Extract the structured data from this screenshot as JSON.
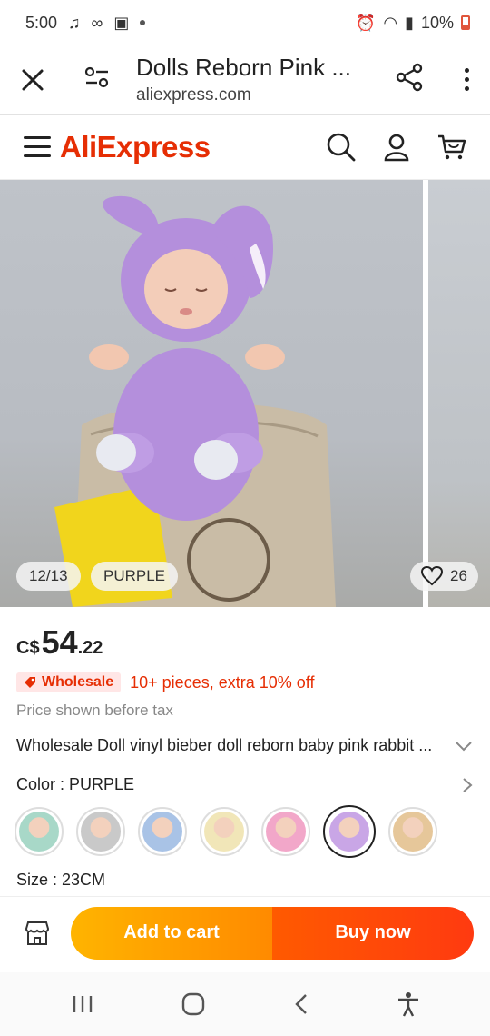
{
  "status": {
    "time": "5:00",
    "battery": "10%"
  },
  "browser": {
    "title": "Dolls Reborn Pink ...",
    "url": "aliexpress.com"
  },
  "site": {
    "logo": "AliExpress"
  },
  "gallery": {
    "counter": "12/13",
    "variant": "PURPLE",
    "favorites": "26"
  },
  "product": {
    "currency": "C$",
    "price_int": "54",
    "price_dec": ".22",
    "wholesale_tag": "Wholesale",
    "wholesale_deal": "10+ pieces, extra 10% off",
    "tax_note": "Price shown before tax",
    "title": "Wholesale Doll vinyl bieber doll reborn baby pink rabbit ...",
    "color_label": "Color : PURPLE",
    "size_label": "Size : 23CM",
    "swatch_colors": [
      "#a8d8c8",
      "#c9c9c9",
      "#a9c3e6",
      "#f1e6b8",
      "#f2a7c9",
      "#c9a6e6",
      "#e6c79a"
    ],
    "selected_swatch": 6
  },
  "actions": {
    "add_to_cart": "Add to cart",
    "buy_now": "Buy now"
  }
}
